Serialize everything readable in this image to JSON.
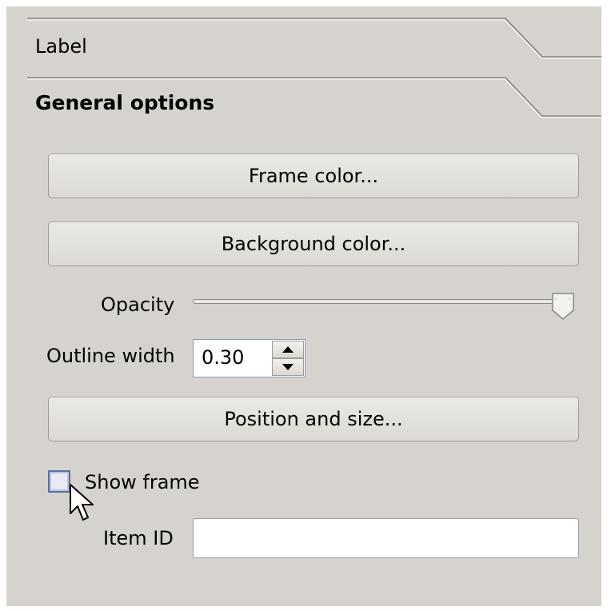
{
  "sections": {
    "label_title": "Label",
    "general_title": "General options"
  },
  "buttons": {
    "frame_color": "Frame color...",
    "background_color": "Background color...",
    "position_size": "Position and size..."
  },
  "opacity": {
    "label": "Opacity",
    "value_fraction": 1.0
  },
  "outline": {
    "label": "Outline width",
    "value": "0.30"
  },
  "show_frame": {
    "label": "Show frame",
    "checked": false
  },
  "item_id": {
    "label": "Item ID",
    "value": ""
  },
  "icons": {
    "spin_up": "arrow-up-icon",
    "spin_down": "arrow-down-icon",
    "cursor": "mouse-pointer-icon"
  },
  "colors": {
    "panel_bg": "#d6d3ce",
    "checkbox_border": "#5a6fa5"
  }
}
